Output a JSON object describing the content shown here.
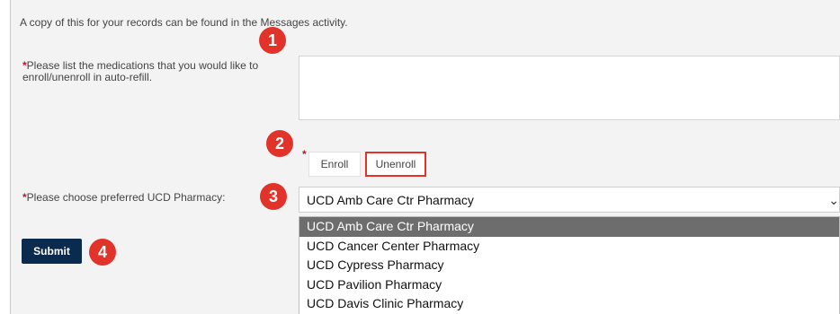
{
  "intro_text": "A copy of this for your records can be found in the Messages activity.",
  "medications": {
    "required_mark": "*",
    "label_line1": "Please list the medications that you would like to",
    "label_line2": "enroll/unenroll in auto-refill.",
    "value": ""
  },
  "enrollment": {
    "required_mark": "*",
    "enroll_label": "Enroll",
    "unenroll_label": "Unenroll"
  },
  "pharmacy": {
    "required_mark": "*",
    "label": "Please choose preferred UCD Pharmacy:",
    "selected": "UCD Amb Care Ctr Pharmacy",
    "options": [
      "UCD Amb Care Ctr Pharmacy",
      "UCD Cancer Center Pharmacy",
      "UCD Cypress Pharmacy",
      "UCD Pavilion Pharmacy",
      "UCD Davis Clinic Pharmacy"
    ]
  },
  "submit_label": "Submit",
  "step_badges": [
    "1",
    "2",
    "3",
    "4"
  ],
  "colors": {
    "required": "#c8102e",
    "badge": "#e2332a",
    "submit_bg": "#0a2a4e",
    "selected_option": "#6d6d6d"
  }
}
